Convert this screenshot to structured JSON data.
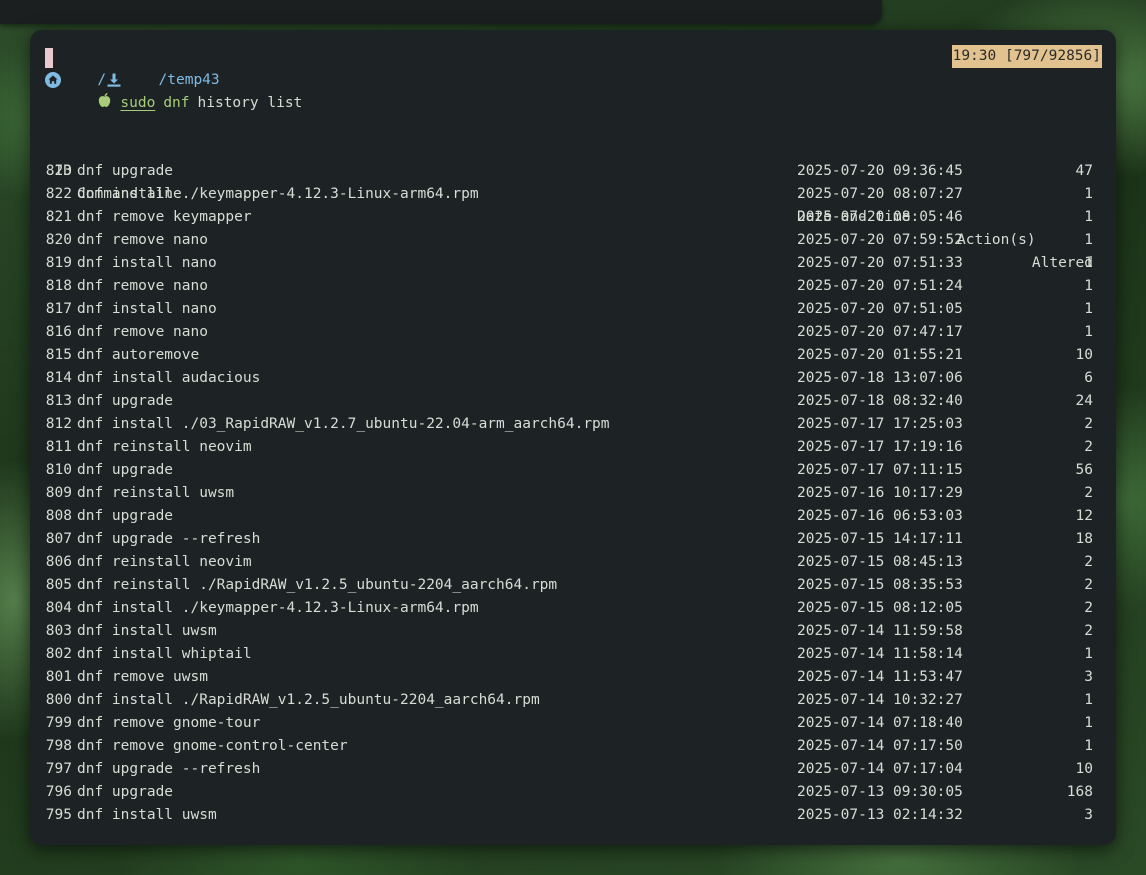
{
  "clock": "19:30 [797/92856]",
  "path": {
    "sep1": "/",
    "sep2": "/",
    "dir": "temp43"
  },
  "prompt": {
    "sudo": "sudo",
    "dnf": "dnf",
    "args": "history list"
  },
  "headers": {
    "id": "ID",
    "command": "Command line",
    "date": "Date and time",
    "actions": "Action(s)",
    "altered": "Altered"
  },
  "rows": [
    {
      "id": "823",
      "cmd": "dnf upgrade",
      "date": "2025-07-20 09:36:45",
      "actions": "",
      "altered": "47"
    },
    {
      "id": "822",
      "cmd": "dnf install ./keymapper-4.12.3-Linux-arm64.rpm",
      "date": "2025-07-20 08:07:27",
      "actions": "",
      "altered": "1"
    },
    {
      "id": "821",
      "cmd": "dnf remove keymapper",
      "date": "2025-07-20 08:05:46",
      "actions": "",
      "altered": "1"
    },
    {
      "id": "820",
      "cmd": "dnf remove nano",
      "date": "2025-07-20 07:59:52",
      "actions": "",
      "altered": "1"
    },
    {
      "id": "819",
      "cmd": "dnf install nano",
      "date": "2025-07-20 07:51:33",
      "actions": "",
      "altered": "1"
    },
    {
      "id": "818",
      "cmd": "dnf remove nano",
      "date": "2025-07-20 07:51:24",
      "actions": "",
      "altered": "1"
    },
    {
      "id": "817",
      "cmd": "dnf install nano",
      "date": "2025-07-20 07:51:05",
      "actions": "",
      "altered": "1"
    },
    {
      "id": "816",
      "cmd": "dnf remove nano",
      "date": "2025-07-20 07:47:17",
      "actions": "",
      "altered": "1"
    },
    {
      "id": "815",
      "cmd": "dnf autoremove",
      "date": "2025-07-20 01:55:21",
      "actions": "",
      "altered": "10"
    },
    {
      "id": "814",
      "cmd": "dnf install audacious",
      "date": "2025-07-18 13:07:06",
      "actions": "",
      "altered": "6"
    },
    {
      "id": "813",
      "cmd": "dnf upgrade",
      "date": "2025-07-18 08:32:40",
      "actions": "",
      "altered": "24"
    },
    {
      "id": "812",
      "cmd": "dnf install ./03_RapidRAW_v1.2.7_ubuntu-22.04-arm_aarch64.rpm",
      "date": "2025-07-17 17:25:03",
      "actions": "",
      "altered": "2"
    },
    {
      "id": "811",
      "cmd": "dnf reinstall neovim",
      "date": "2025-07-17 17:19:16",
      "actions": "",
      "altered": "2"
    },
    {
      "id": "810",
      "cmd": "dnf upgrade",
      "date": "2025-07-17 07:11:15",
      "actions": "",
      "altered": "56"
    },
    {
      "id": "809",
      "cmd": "dnf reinstall uwsm",
      "date": "2025-07-16 10:17:29",
      "actions": "",
      "altered": "2"
    },
    {
      "id": "808",
      "cmd": "dnf upgrade",
      "date": "2025-07-16 06:53:03",
      "actions": "",
      "altered": "12"
    },
    {
      "id": "807",
      "cmd": "dnf upgrade --refresh",
      "date": "2025-07-15 14:17:11",
      "actions": "",
      "altered": "18"
    },
    {
      "id": "806",
      "cmd": "dnf reinstall neovim",
      "date": "2025-07-15 08:45:13",
      "actions": "",
      "altered": "2"
    },
    {
      "id": "805",
      "cmd": "dnf reinstall ./RapidRAW_v1.2.5_ubuntu-2204_aarch64.rpm",
      "date": "2025-07-15 08:35:53",
      "actions": "",
      "altered": "2"
    },
    {
      "id": "804",
      "cmd": "dnf install ./keymapper-4.12.3-Linux-arm64.rpm",
      "date": "2025-07-15 08:12:05",
      "actions": "",
      "altered": "2"
    },
    {
      "id": "803",
      "cmd": "dnf install uwsm",
      "date": "2025-07-14 11:59:58",
      "actions": "",
      "altered": "2"
    },
    {
      "id": "802",
      "cmd": "dnf install whiptail",
      "date": "2025-07-14 11:58:14",
      "actions": "",
      "altered": "1"
    },
    {
      "id": "801",
      "cmd": "dnf remove uwsm",
      "date": "2025-07-14 11:53:47",
      "actions": "",
      "altered": "3"
    },
    {
      "id": "800",
      "cmd": "dnf install ./RapidRAW_v1.2.5_ubuntu-2204_aarch64.rpm",
      "date": "2025-07-14 10:32:27",
      "actions": "",
      "altered": "1"
    },
    {
      "id": "799",
      "cmd": "dnf remove gnome-tour",
      "date": "2025-07-14 07:18:40",
      "actions": "",
      "altered": "1"
    },
    {
      "id": "798",
      "cmd": "dnf remove gnome-control-center",
      "date": "2025-07-14 07:17:50",
      "actions": "",
      "altered": "1"
    },
    {
      "id": "797",
      "cmd": "dnf upgrade --refresh",
      "date": "2025-07-14 07:17:04",
      "actions": "",
      "altered": "10"
    },
    {
      "id": "796",
      "cmd": "dnf upgrade",
      "date": "2025-07-13 09:30:05",
      "actions": "",
      "altered": "168"
    },
    {
      "id": "795",
      "cmd": "dnf install uwsm",
      "date": "2025-07-13 02:14:32",
      "actions": "",
      "altered": "3"
    }
  ]
}
